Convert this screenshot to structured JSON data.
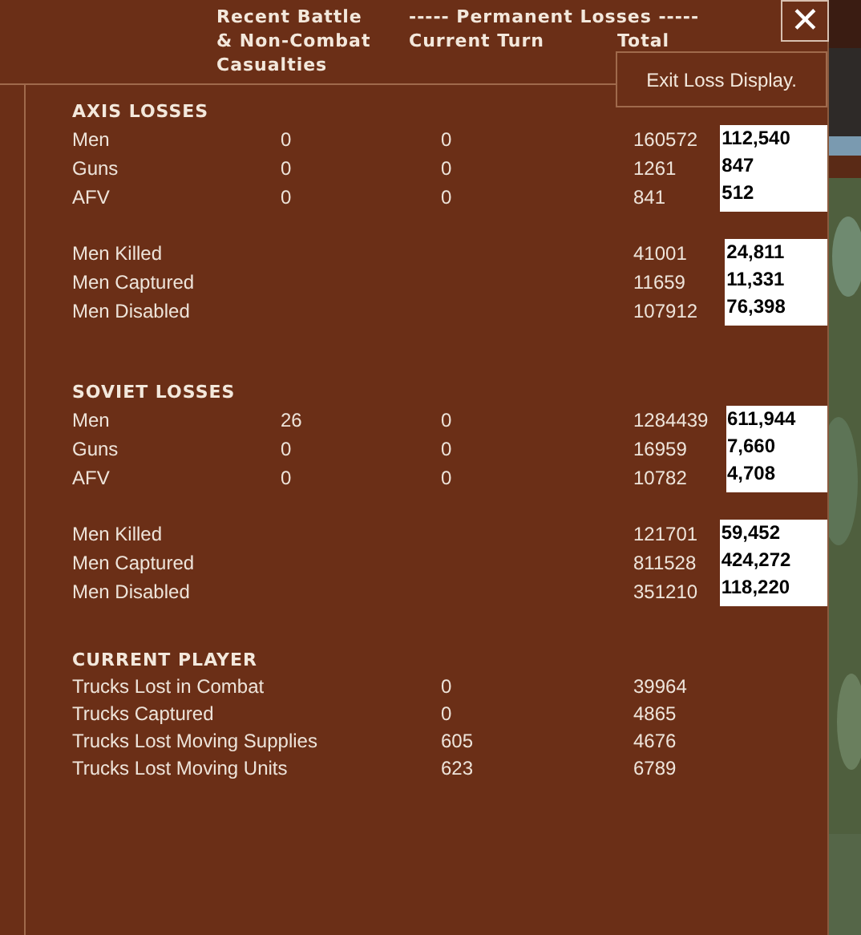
{
  "header": {
    "recent": [
      "Recent Battle",
      "& Non-Combat",
      "Casualties"
    ],
    "permanent": "----- Permanent Losses -----",
    "current_turn": "Current Turn",
    "total": "Total"
  },
  "close_button": {
    "label": "✕"
  },
  "tooltip": "Exit Loss Display.",
  "sections": [
    {
      "title": "AXIS LOSSES",
      "groups": [
        {
          "rows": [
            {
              "label": "Men",
              "recent": "0",
              "current": "0",
              "total": "160572",
              "note": "112,540"
            },
            {
              "label": "Guns",
              "recent": "0",
              "current": "0",
              "total": "1261",
              "note": "847"
            },
            {
              "label": "AFV",
              "recent": "0",
              "current": "0",
              "total": "841",
              "note": "512"
            }
          ]
        },
        {
          "rows": [
            {
              "label": "Men Killed",
              "total": "41001",
              "note": "24,811"
            },
            {
              "label": "Men Captured",
              "total": "11659",
              "note": "11,331"
            },
            {
              "label": "Men Disabled",
              "total": "107912",
              "note": "76,398"
            }
          ]
        }
      ]
    },
    {
      "title": "SOVIET LOSSES",
      "groups": [
        {
          "rows": [
            {
              "label": "Men",
              "recent": "26",
              "current": "0",
              "total": "1284439",
              "note": "611,944"
            },
            {
              "label": "Guns",
              "recent": "0",
              "current": "0",
              "total": "16959",
              "note": "7,660"
            },
            {
              "label": "AFV",
              "recent": "0",
              "current": "0",
              "total": "10782",
              "note": "4,708"
            }
          ]
        },
        {
          "rows": [
            {
              "label": "Men Killed",
              "total": "121701",
              "note": "59,452"
            },
            {
              "label": "Men Captured",
              "total": "811528",
              "note": "424,272"
            },
            {
              "label": "Men Disabled",
              "total": "351210",
              "note": "118,220"
            }
          ]
        }
      ]
    }
  ],
  "player": {
    "title": "CURRENT PLAYER",
    "rows": [
      {
        "label": "Trucks Lost in Combat",
        "current": "0",
        "total": "39964"
      },
      {
        "label": "Trucks Captured",
        "current": "0",
        "total": "4865"
      },
      {
        "label": "Trucks Lost Moving Supplies",
        "current": "605",
        "total": "4676"
      },
      {
        "label": "Trucks Lost Moving Units",
        "current": "623",
        "total": "6789"
      }
    ]
  }
}
